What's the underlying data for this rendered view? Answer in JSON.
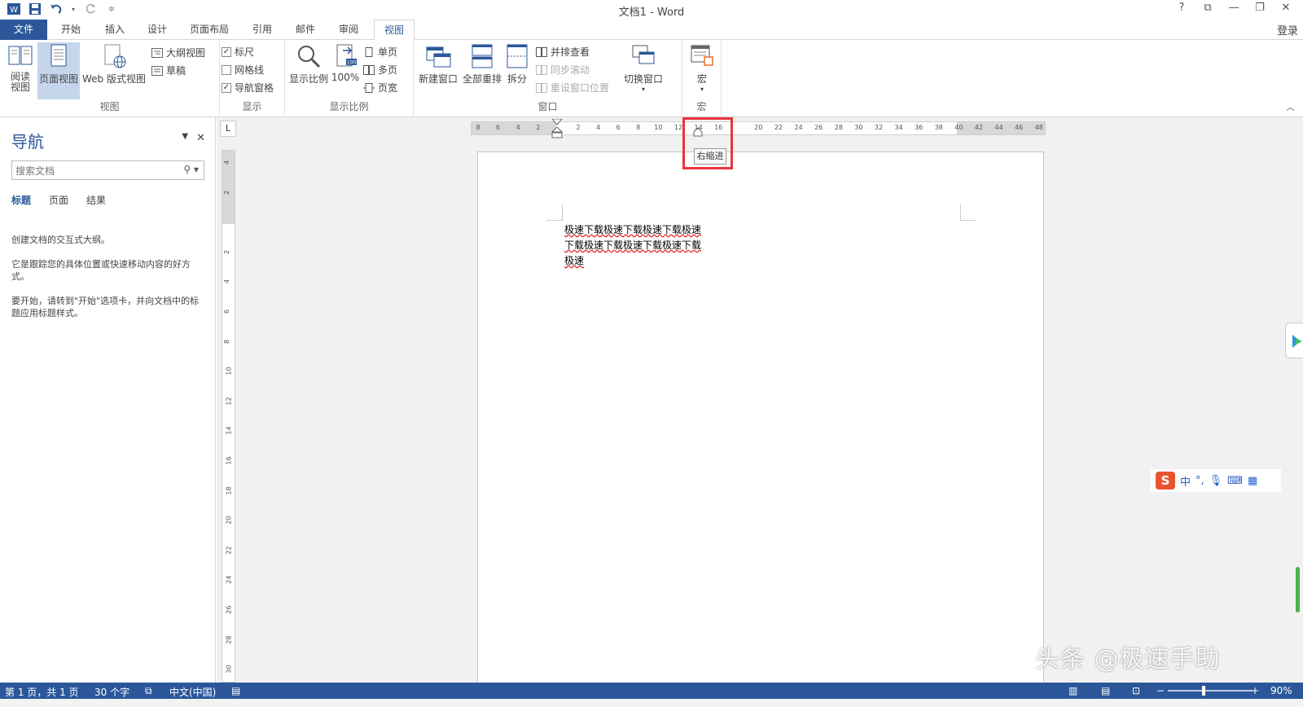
{
  "window": {
    "title": "文档1 - Word",
    "help": "?",
    "login": "登录"
  },
  "tabs": [
    "文件",
    "开始",
    "插入",
    "设计",
    "页面布局",
    "引用",
    "邮件",
    "审阅",
    "视图"
  ],
  "active_tab": "视图",
  "ribbon": {
    "views": {
      "label": "视图",
      "read": "阅读\n视图",
      "read_l1": "阅读",
      "read_l2": "视图",
      "print_layout": "页面视图",
      "web_layout": "Web 版式视图",
      "outline": "大纲视图",
      "draft": "草稿"
    },
    "show": {
      "label": "显示",
      "ruler": "标尺",
      "ruler_checked": true,
      "gridlines": "网格线",
      "gridlines_checked": false,
      "nav_pane": "导航窗格",
      "nav_pane_checked": true
    },
    "zoom": {
      "label": "显示比例",
      "zoom": "显示比例",
      "hundred": "100%",
      "one_page": "单页",
      "multi_page": "多页",
      "page_width": "页宽"
    },
    "window": {
      "label": "窗口",
      "new_window": "新建窗口",
      "arrange_all": "全部重排",
      "split": "拆分",
      "side_by_side": "并排查看",
      "sync_scroll": "同步滚动",
      "reset_position": "重设窗口位置",
      "switch_windows": "切换窗口"
    },
    "macros": {
      "label": "宏",
      "macros": "宏"
    }
  },
  "nav": {
    "title": "导航",
    "search_placeholder": "搜索文档",
    "tabs": [
      "标题",
      "页面",
      "结果"
    ],
    "active_tab": "标题",
    "text1": "创建文档的交互式大纲。",
    "text2": "它是跟踪您的具体位置或快速移动内容的好方式。",
    "text3": "要开始，请转到\"开始\"选项卡，并向文档中的标题应用标题样式。"
  },
  "ruler": {
    "corner": "L",
    "h_ticks": [
      "8",
      "6",
      "4",
      "2",
      "",
      "2",
      "4",
      "6",
      "8",
      "10",
      "12",
      "14",
      "16",
      "",
      "20",
      "22",
      "24",
      "26",
      "28",
      "30",
      "32",
      "34",
      "36",
      "38",
      "40",
      "42",
      "44",
      "46",
      "48"
    ],
    "v_ticks": [
      "4",
      "2",
      "",
      "2",
      "4",
      "6",
      "8",
      "10",
      "12",
      "14",
      "16",
      "18",
      "20",
      "22",
      "24",
      "26",
      "28",
      "30"
    ],
    "tooltip": "右缩进"
  },
  "document": {
    "line1": "极速下载极速下载极速下载极速",
    "line2": "下载极速下载极速下载极速下载",
    "line3": "极速"
  },
  "ime": {
    "logo": "S",
    "lang": "中",
    "punct": "°,"
  },
  "watermark": "头条 @极速手助",
  "status": {
    "page": "第 1 页，共 1 页",
    "words": "30 个字",
    "language": "中文(中国)",
    "zoom": "90%",
    "zoom_value": 0.9
  },
  "colors": {
    "accent": "#2b579a",
    "highlight_box": "#e8343a"
  }
}
